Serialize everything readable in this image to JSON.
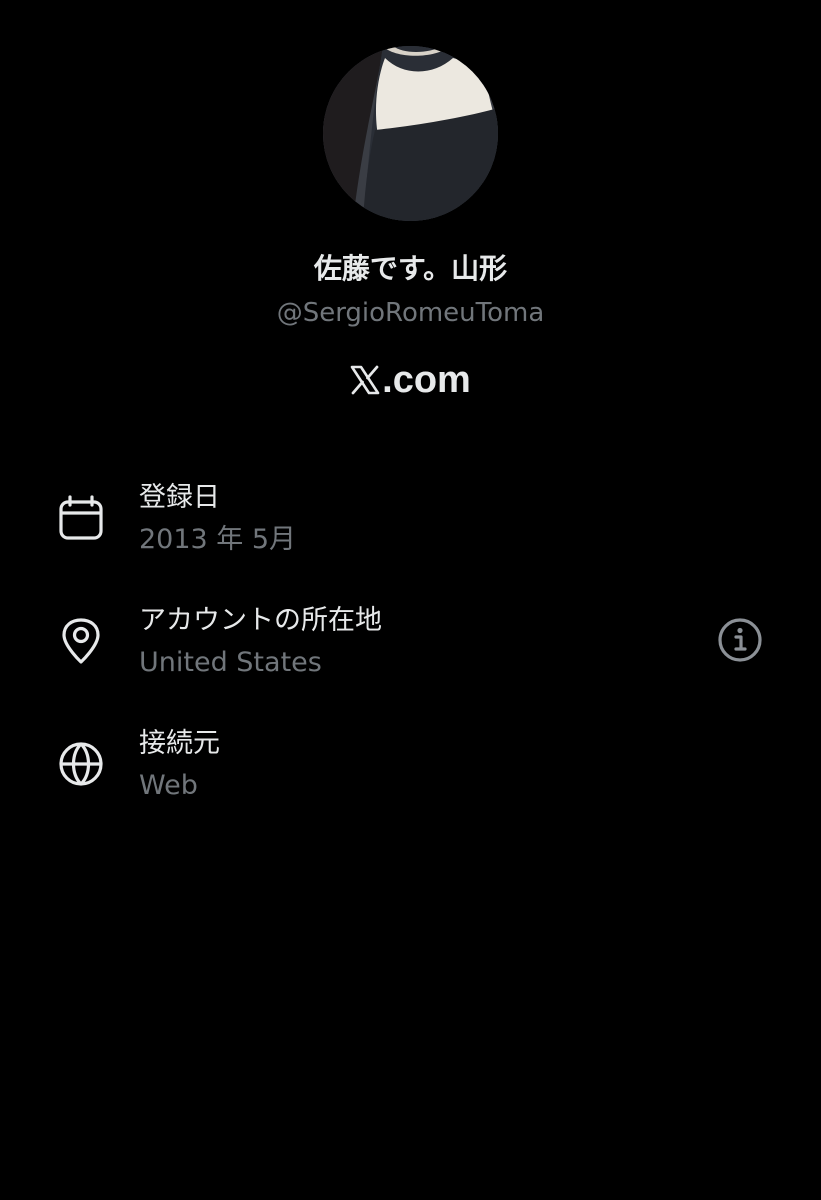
{
  "profile": {
    "display_name": "佐藤です。山形",
    "handle": "@SergioRomeuToma",
    "avatar_alt": "profile photo"
  },
  "brand": {
    "logo_icon": "x-logo-icon",
    "suffix": ".com"
  },
  "info": [
    {
      "icon": "calendar-icon",
      "title": "登録日",
      "value": "2013 年 5月"
    },
    {
      "icon": "location-pin-icon",
      "title": "アカウントの所在地",
      "value": "United States",
      "action_icon": "info-icon"
    },
    {
      "icon": "globe-icon",
      "title": "接続元",
      "value": "Web"
    }
  ],
  "colors": {
    "background": "#000000",
    "primary_text": "#e7e9ea",
    "secondary_text": "#71767b"
  }
}
